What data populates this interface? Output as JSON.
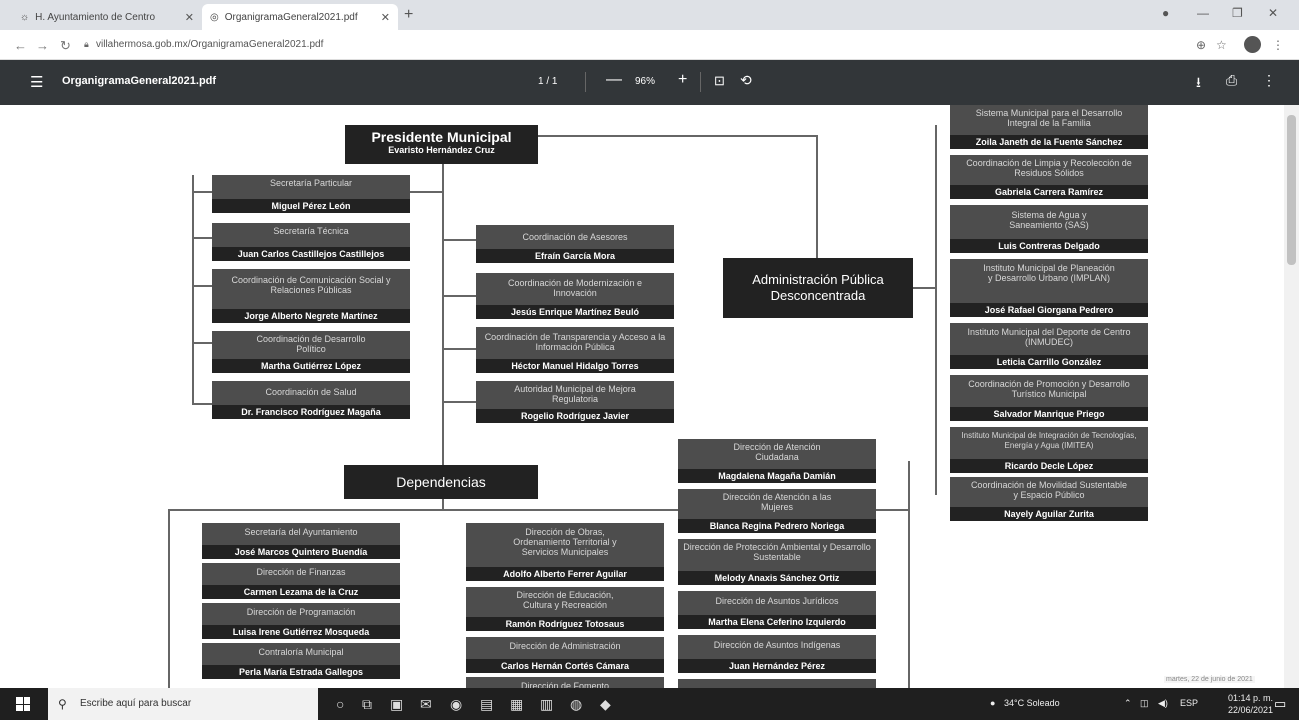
{
  "browser": {
    "tabs": [
      {
        "label": "H. Ayuntamiento de Centro"
      },
      {
        "label": "OrganigramaGeneral2021.pdf"
      }
    ],
    "url": "villahermosa.gob.mx/OrganigramaGeneral2021.pdf"
  },
  "pdf": {
    "filename": "OrganigramaGeneral2021.pdf",
    "page_indicator": "1 / 1",
    "zoom": "96%"
  },
  "chart": {
    "president": {
      "title": "Presidente Municipal",
      "name": "Evaristo Hernández Cruz"
    },
    "admin_publica": "Administración Pública Desconcentrada",
    "dependencias": "Dependencias",
    "left_col": [
      {
        "title": "Secretaría Particular",
        "name": "Miguel Pérez León"
      },
      {
        "title": "Secretaría Técnica",
        "name": "Juan Carlos Castillejos Castillejos"
      },
      {
        "title": "Coordinación de Comunicación Social y Relaciones Públicas",
        "name": "Jorge Alberto Negrete Martínez"
      },
      {
        "title": "Coordinación de Desarrollo Político",
        "name": "Martha Gutiérrez López"
      },
      {
        "title": "Coordinación de Salud",
        "name": "Dr. Francisco Rodríguez Magaña"
      }
    ],
    "mid_col": [
      {
        "title": "Coordinación de Asesores",
        "name": "Efraín García Mora"
      },
      {
        "title": "Coordinación de Modernización e Innovación",
        "name": "Jesús Enrique Martínez Beuló"
      },
      {
        "title": "Coordinación de Transparencia y Acceso a la Información Pública",
        "name": "Héctor Manuel Hidalgo Torres"
      },
      {
        "title": "Autoridad Municipal de Mejora Regulatoria",
        "name": "Rogelio Rodríguez Javier"
      }
    ],
    "right_col": [
      {
        "title": "Sistema Municipal para el Desarrollo Integral de la Familia",
        "name": "Zoila Janeth de la Fuente Sánchez"
      },
      {
        "title": "Coordinación de Limpia y Recolección de Residuos Sólidos",
        "name": "Gabriela Carrera Ramírez"
      },
      {
        "title": "Sistema de Agua y Saneamiento (SAS)",
        "name": "Luis Contreras Delgado"
      },
      {
        "title": "Instituto Municipal de Planeación y Desarrollo Urbano (IMPLAN)",
        "name": "José Rafael Giorgana Pedrero"
      },
      {
        "title": "Instituto Municipal del Deporte de Centro (INMUDEC)",
        "name": "Leticia Carrillo González"
      },
      {
        "title": "Coordinación de Promoción y Desarrollo Turístico Municipal",
        "name": "Salvador Manrique Priego"
      },
      {
        "title": "Instituto Municipal de Integración de Tecnologías, Energía y Agua (IMITEA)",
        "name": "Ricardo Decle López"
      },
      {
        "title": "Coordinación de Movilidad Sustentable y Espacio Público",
        "name": "Nayely Aguilar Zurita"
      }
    ],
    "dep_col1": [
      {
        "title": "Secretaría del Ayuntamiento",
        "name": "José Marcos Quintero Buendía"
      },
      {
        "title": "Dirección de Finanzas",
        "name": "Carmen Lezama de la Cruz"
      },
      {
        "title": "Dirección de Programación",
        "name": "Luisa Irene Gutiérrez Mosqueda"
      },
      {
        "title": "Contraloría Municipal",
        "name": "Perla María Estrada Gallegos"
      }
    ],
    "dep_col2": [
      {
        "title": "Dirección de Obras, Ordenamiento Territorial y Servicios Municipales",
        "name": "Adolfo Alberto Ferrer Aguilar"
      },
      {
        "title": "Dirección de Educación, Cultura y Recreación",
        "name": "Ramón Rodríguez Totosaus"
      },
      {
        "title": "Dirección de Administración",
        "name": "Carlos Hernán Cortés Cámara"
      },
      {
        "title": "Dirección de Fomento",
        "name": ""
      }
    ],
    "dep_col3": [
      {
        "title": "Dirección de Atención Ciudadana",
        "name": "Magdalena Magaña Damián"
      },
      {
        "title": "Dirección de Atención a las Mujeres",
        "name": "Blanca Regina Pedrero Noriega"
      },
      {
        "title": "Dirección de Protección Ambiental y Desarrollo Sustentable",
        "name": "Melody Anaxis Sánchez Ortiz"
      },
      {
        "title": "Dirección de Asuntos Jurídicos",
        "name": "Martha Elena Ceferino Izquierdo"
      },
      {
        "title": "Dirección de Asuntos Indígenas",
        "name": "Juan Hernández Pérez"
      }
    ]
  },
  "taskbar": {
    "search_placeholder": "Escribe aquí para buscar",
    "weather": "34°C Soleado",
    "lang": "ESP",
    "time": "01:14 p. m.",
    "date": "22/06/2021",
    "date_hint": "martes, 22 de junio de 2021"
  }
}
